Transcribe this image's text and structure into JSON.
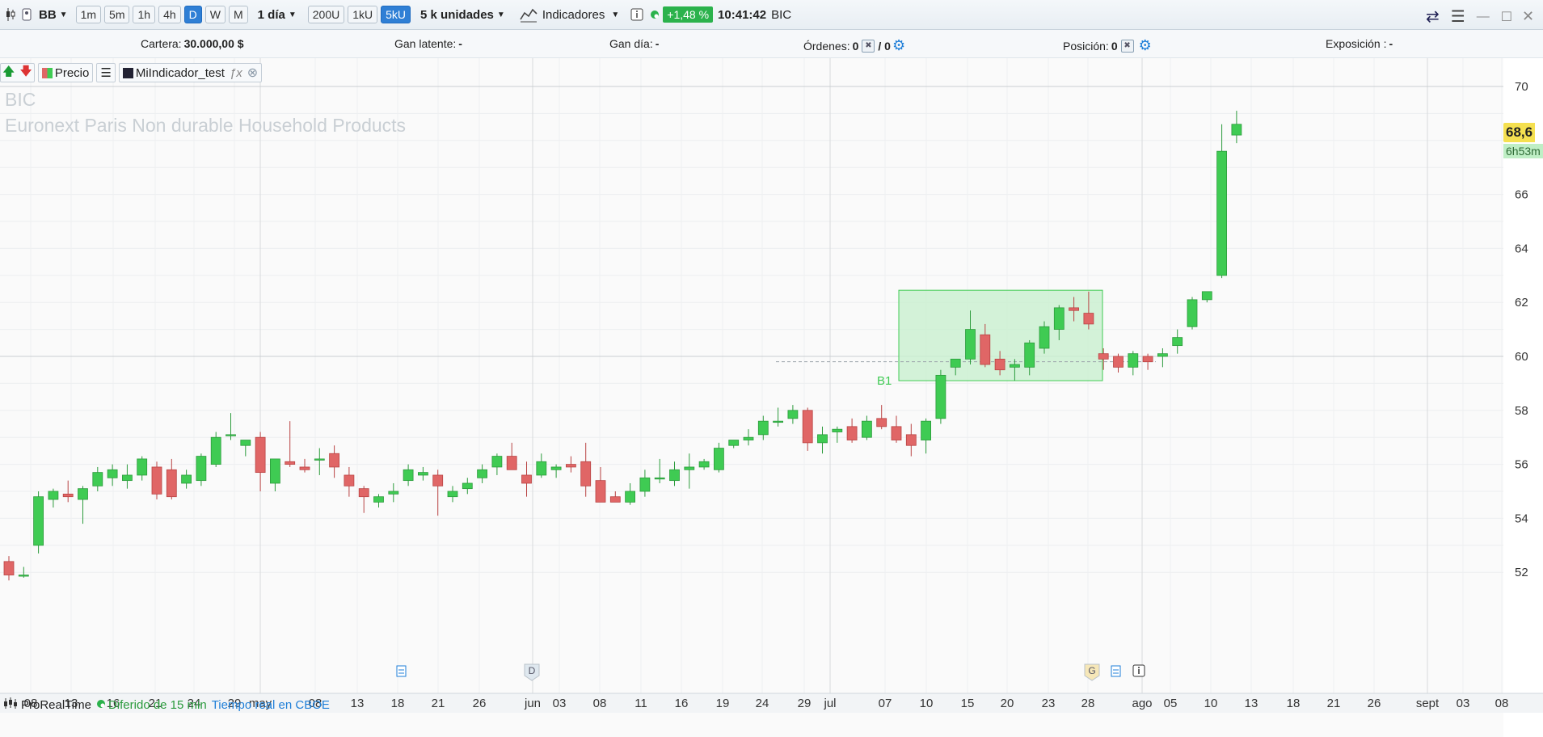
{
  "toolbar": {
    "instrument_type": "BB",
    "intervals": [
      "1m",
      "5m",
      "1h",
      "4h",
      "D",
      "W",
      "M"
    ],
    "active_interval": "D",
    "period": "1 día",
    "units": [
      "200U",
      "1kU",
      "5kU"
    ],
    "active_unit": "5kU",
    "units_select": "5 k unidades",
    "indicators_label": "Indicadores",
    "change_pct": "+1,48 %",
    "time": "10:41:42",
    "ticker": "BIC"
  },
  "account": {
    "cartera_label": "Cartera:",
    "cartera_value": "30.000,00 $",
    "gan_latente_label": "Gan latente:",
    "gan_latente_value": "-",
    "gan_dia_label": "Gan día:",
    "gan_dia_value": "-",
    "ordenes_label": "Órdenes:",
    "ordenes_value": "0",
    "ordenes_total": "/ 0",
    "posicion_label": "Posición:",
    "posicion_value": "0",
    "exposicion_label": "Exposición :",
    "exposicion_value": "-"
  },
  "legend": {
    "price_label": "Precio",
    "indicator_label": "MiIndicador_test"
  },
  "watermark": {
    "ticker": "BIC",
    "description": "Euronext Paris  Non durable Household Products"
  },
  "price_axis": {
    "ticks": [
      "70",
      "66",
      "64",
      "62",
      "60",
      "58",
      "56",
      "54",
      "52"
    ],
    "last_price": "68,6",
    "countdown": "6h53m"
  },
  "footer": {
    "brand": "ProRealTime",
    "delay_text": "Diferido de 15 min",
    "realtime_text": "Tiempo real en CBOE"
  },
  "markers": {
    "signal_label": "B1",
    "event_d": "D",
    "event_g": "G"
  },
  "colors": {
    "up": "#3fcb53",
    "down": "#e06666",
    "box": "#c9f0cf",
    "accent": "#2f7fd5"
  },
  "chart_data": {
    "type": "candlestick",
    "title": "",
    "ylim": [
      51.5,
      70.5
    ],
    "x_ticks": [
      "08",
      "13",
      "16",
      "21",
      "24",
      "29",
      "may",
      "08",
      "13",
      "18",
      "21",
      "26",
      "jun",
      "03",
      "08",
      "11",
      "16",
      "19",
      "24",
      "29",
      "jul",
      "07",
      "10",
      "15",
      "20",
      "23",
      "28",
      "ago",
      "05",
      "10",
      "13",
      "18",
      "21",
      "26",
      "sept",
      "03",
      "08"
    ],
    "ohlc": [
      [
        52.4,
        52.6,
        51.7,
        51.9
      ],
      [
        51.9,
        52.2,
        51.8,
        51.9
      ],
      [
        53.0,
        55.0,
        52.7,
        54.8
      ],
      [
        54.7,
        55.1,
        54.4,
        55.0
      ],
      [
        54.9,
        55.4,
        54.6,
        54.8
      ],
      [
        54.7,
        55.2,
        53.8,
        55.1
      ],
      [
        55.2,
        55.9,
        55.0,
        55.7
      ],
      [
        55.5,
        56.0,
        55.2,
        55.8
      ],
      [
        55.4,
        56.0,
        55.1,
        55.6
      ],
      [
        55.6,
        56.3,
        55.4,
        56.2
      ],
      [
        55.9,
        56.1,
        54.7,
        54.9
      ],
      [
        55.8,
        56.2,
        54.7,
        54.8
      ],
      [
        55.3,
        55.8,
        55.1,
        55.6
      ],
      [
        55.4,
        56.4,
        55.2,
        56.3
      ],
      [
        56.0,
        57.2,
        55.9,
        57.0
      ],
      [
        57.1,
        57.9,
        56.9,
        57.1
      ],
      [
        56.7,
        56.9,
        56.3,
        56.9
      ],
      [
        57.0,
        57.2,
        55.0,
        55.7
      ],
      [
        55.3,
        56.1,
        55.0,
        56.2
      ],
      [
        56.1,
        57.6,
        55.9,
        56.0
      ],
      [
        55.9,
        56.2,
        55.7,
        55.8
      ],
      [
        56.2,
        56.6,
        55.6,
        56.2
      ],
      [
        56.4,
        56.7,
        55.5,
        55.9
      ],
      [
        55.6,
        55.9,
        54.8,
        55.2
      ],
      [
        55.1,
        55.2,
        54.2,
        54.8
      ],
      [
        54.6,
        54.9,
        54.4,
        54.8
      ],
      [
        54.9,
        55.3,
        54.6,
        55.0
      ],
      [
        55.4,
        56.0,
        55.2,
        55.8
      ],
      [
        55.6,
        55.9,
        55.4,
        55.7
      ],
      [
        55.6,
        55.8,
        54.1,
        55.2
      ],
      [
        54.8,
        55.2,
        54.6,
        55.0
      ],
      [
        55.1,
        55.5,
        54.9,
        55.3
      ],
      [
        55.5,
        56.0,
        55.3,
        55.8
      ],
      [
        55.9,
        56.4,
        55.6,
        56.3
      ],
      [
        56.3,
        56.8,
        55.9,
        55.8
      ],
      [
        55.6,
        56.1,
        54.8,
        55.3
      ],
      [
        55.6,
        56.4,
        55.5,
        56.1
      ],
      [
        55.8,
        56.0,
        55.5,
        55.9
      ],
      [
        56.0,
        56.3,
        55.7,
        55.9
      ],
      [
        56.1,
        56.8,
        54.8,
        55.2
      ],
      [
        55.4,
        55.9,
        55.0,
        54.6
      ],
      [
        54.8,
        55.0,
        54.6,
        54.6
      ],
      [
        54.6,
        55.3,
        54.5,
        55.0
      ],
      [
        55.0,
        55.8,
        54.8,
        55.5
      ],
      [
        55.5,
        56.2,
        55.3,
        55.5
      ],
      [
        55.4,
        56.1,
        55.2,
        55.8
      ],
      [
        55.8,
        56.4,
        55.1,
        55.9
      ],
      [
        55.9,
        56.2,
        55.8,
        56.1
      ],
      [
        55.8,
        56.8,
        55.7,
        56.6
      ],
      [
        56.7,
        56.9,
        56.6,
        56.9
      ],
      [
        56.9,
        57.3,
        56.7,
        57.0
      ],
      [
        57.1,
        57.8,
        56.9,
        57.6
      ],
      [
        57.6,
        58.1,
        57.4,
        57.6
      ],
      [
        57.7,
        58.2,
        57.5,
        58.0
      ],
      [
        58.0,
        58.1,
        56.5,
        56.8
      ],
      [
        56.8,
        57.4,
        56.4,
        57.1
      ],
      [
        57.2,
        57.4,
        56.8,
        57.3
      ],
      [
        57.4,
        57.7,
        56.8,
        56.9
      ],
      [
        57.0,
        57.8,
        56.9,
        57.6
      ],
      [
        57.7,
        58.2,
        57.3,
        57.4
      ],
      [
        57.4,
        57.8,
        56.8,
        56.9
      ],
      [
        57.1,
        57.5,
        56.3,
        56.7
      ],
      [
        56.9,
        57.7,
        56.4,
        57.6
      ],
      [
        57.7,
        59.5,
        57.5,
        59.3
      ],
      [
        59.6,
        59.9,
        59.3,
        59.9
      ],
      [
        59.9,
        61.7,
        59.7,
        61.0
      ],
      [
        60.8,
        61.2,
        59.6,
        59.7
      ],
      [
        59.9,
        60.2,
        59.3,
        59.5
      ],
      [
        59.6,
        59.9,
        59.1,
        59.7
      ],
      [
        59.6,
        60.6,
        59.3,
        60.5
      ],
      [
        60.3,
        61.3,
        60.1,
        61.1
      ],
      [
        61.0,
        61.9,
        60.6,
        61.8
      ],
      [
        61.8,
        62.2,
        61.3,
        61.7
      ],
      [
        61.6,
        62.4,
        61.0,
        61.2
      ],
      [
        60.1,
        60.3,
        59.5,
        59.9
      ],
      [
        60.0,
        60.1,
        59.4,
        59.6
      ],
      [
        59.6,
        60.2,
        59.3,
        60.1
      ],
      [
        60.0,
        60.1,
        59.5,
        59.8
      ],
      [
        60.0,
        60.3,
        59.6,
        60.1
      ],
      [
        60.4,
        61.0,
        60.1,
        60.7
      ],
      [
        61.1,
        62.2,
        61.0,
        62.1
      ],
      [
        62.1,
        62.4,
        62.0,
        62.4
      ],
      [
        63.0,
        68.6,
        62.9,
        67.6
      ],
      [
        68.2,
        69.1,
        67.9,
        68.6
      ]
    ]
  }
}
